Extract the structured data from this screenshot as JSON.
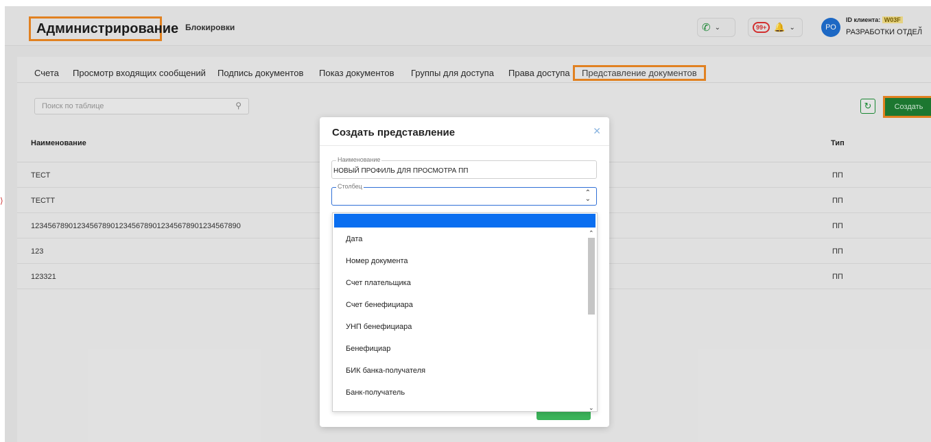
{
  "header": {
    "app_title": "Администрирование",
    "nav_link": "Блокировки",
    "notifications_badge": "99+",
    "avatar_initials": "РО",
    "client_id_label": "ID клиента:",
    "client_id_value": "W03F",
    "client_name": "РАЗРАБОТКИ ОТДЕЛ"
  },
  "tabs": [
    {
      "label": "Счета"
    },
    {
      "label": "Просмотр входящих сообщений"
    },
    {
      "label": "Подпись документов"
    },
    {
      "label": "Показ документов"
    },
    {
      "label": "Группы для доступа"
    },
    {
      "label": "Права доступа"
    },
    {
      "label": "Представление документов",
      "active": true
    }
  ],
  "toolbar": {
    "search_placeholder": "Поиск по таблице",
    "create_label": "Создать"
  },
  "table": {
    "columns": [
      "Наименование",
      "Тип"
    ],
    "rows": [
      [
        "ТЕСТ",
        "ПП"
      ],
      [
        "ТЕСТТ",
        "ПП"
      ],
      [
        "1234567890123456789012345678901234567890123456789​0",
        "ПП"
      ],
      [
        "123",
        "ПП"
      ],
      [
        "123321",
        "ПП"
      ]
    ]
  },
  "modal": {
    "title": "Создать представление",
    "name_label": "Наименование",
    "name_value": "НОВЫЙ ПРОФИЛЬ ДЛЯ ПРОСМОТРА ПП",
    "column_label": "Столбец",
    "column_value": ""
  },
  "dropdown": {
    "options": [
      "Дата",
      "Номер документа",
      "Счет плательщика",
      "Счет бенефициара",
      "УНП бенефициара",
      "Бенефициар",
      "БИК банка-получателя",
      "Банк-получатель"
    ]
  },
  "colors": {
    "accent_orange": "#f08a24",
    "brand_green": "#1e7f34",
    "selection_blue": "#0a6ef0"
  }
}
